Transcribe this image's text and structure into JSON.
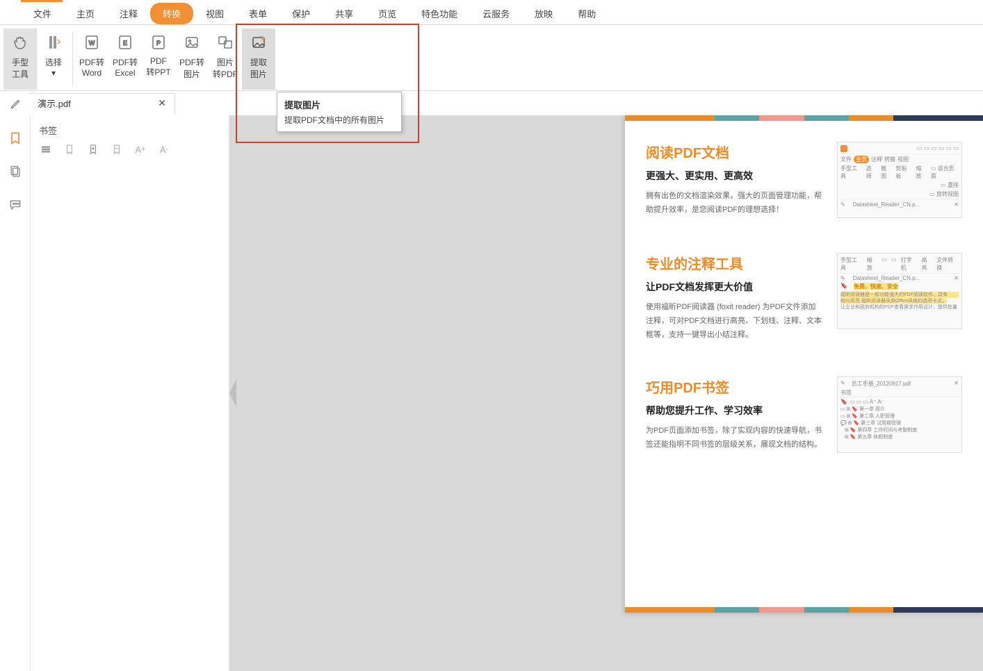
{
  "menu": {
    "items": [
      "文件",
      "主页",
      "注释",
      "转换",
      "视图",
      "表单",
      "保护",
      "共享",
      "页览",
      "特色功能",
      "云服务",
      "放映",
      "帮助"
    ],
    "active_index": 3
  },
  "ribbon": [
    {
      "label1": "手型",
      "label2": "工具",
      "icon": "hand",
      "active": true
    },
    {
      "label1": "选择",
      "label2": "▾",
      "icon": "select"
    },
    {
      "label1": "PDF转",
      "label2": "Word",
      "icon": "word"
    },
    {
      "label1": "PDF转",
      "label2": "Excel",
      "icon": "excel"
    },
    {
      "label1": "PDF",
      "label2": "转PPT",
      "icon": "ppt"
    },
    {
      "label1": "PDF转",
      "label2": "图片",
      "icon": "img"
    },
    {
      "label1": "图片",
      "label2": "转PDF",
      "icon": "img2"
    },
    {
      "label1": "提取",
      "label2": "图片",
      "icon": "extract",
      "hover": true
    }
  ],
  "tooltip": {
    "title": "提取图片",
    "body": "提取PDF文档中的所有图片"
  },
  "tab": {
    "title": "演示.pdf"
  },
  "bookmark_panel": {
    "title": "书签"
  },
  "page": {
    "sections": [
      {
        "title": "阅读PDF文档",
        "sub": "更强大、更实用、更高效",
        "body": "拥有出色的文档渲染效果，强大的页面管理功能，帮助提升效率，是您阅读PDF的理想选择！",
        "thumb_tabs": [
          "文件",
          "主页",
          "注释",
          "转换",
          "视图"
        ],
        "thumb_tools": [
          "手型工具",
          "选择",
          "截图",
          "剪贴板",
          "缩放"
        ],
        "thumb_file": "Datasheet_Reader_CN.p...",
        "thumb_side": [
          "适合页面",
          "重排",
          "旋转视图"
        ]
      },
      {
        "title": "专业的注释工具",
        "sub": "让PDF文档发挥更大价值",
        "body": "使用福昕PDF阅读器 (foxit reader) 为PDF文件添加注释，可对PDF文档进行高亮、下划线、注释、文本框等，支持一键导出小结注释。",
        "thumb_tools": [
          "手型工具",
          "缩放",
          "打字机",
          "高亮",
          "文件转换"
        ],
        "thumb_file": "Datasheet_Reader_CN.p...",
        "thumb_hl": "免费、快速、安全",
        "thumb_lines": [
          "福昕阅读器是一款功能强大的PDF阅读软件，具有",
          "相与高亮 福昕阅读器采用Office风格的选项卡式，",
          "让企业和政府机构的PDF查看需求作用设计，提供批量"
        ]
      },
      {
        "title": "巧用PDF书签",
        "sub": "帮助您提升工作、学习效率",
        "body": "为PDF页面添加书签，除了实现内容的快速导航，书签还能指明不同书签的层级关系，展现文档的结构。",
        "thumb_file": "员工手册_20120917.pdf",
        "thumb_bm_title": "书签",
        "thumb_chapters": [
          "第一章  简介",
          "第二章  入职管理",
          "第三章  试用期管理",
          "第四章  工作时间与考勤制度",
          "第五章  休假制度"
        ]
      }
    ],
    "stripe": [
      "#ed8b27",
      "#5da3a6",
      "#ef9a8d",
      "#5da3a6",
      "#ed8b27",
      "#2e3a59"
    ]
  }
}
